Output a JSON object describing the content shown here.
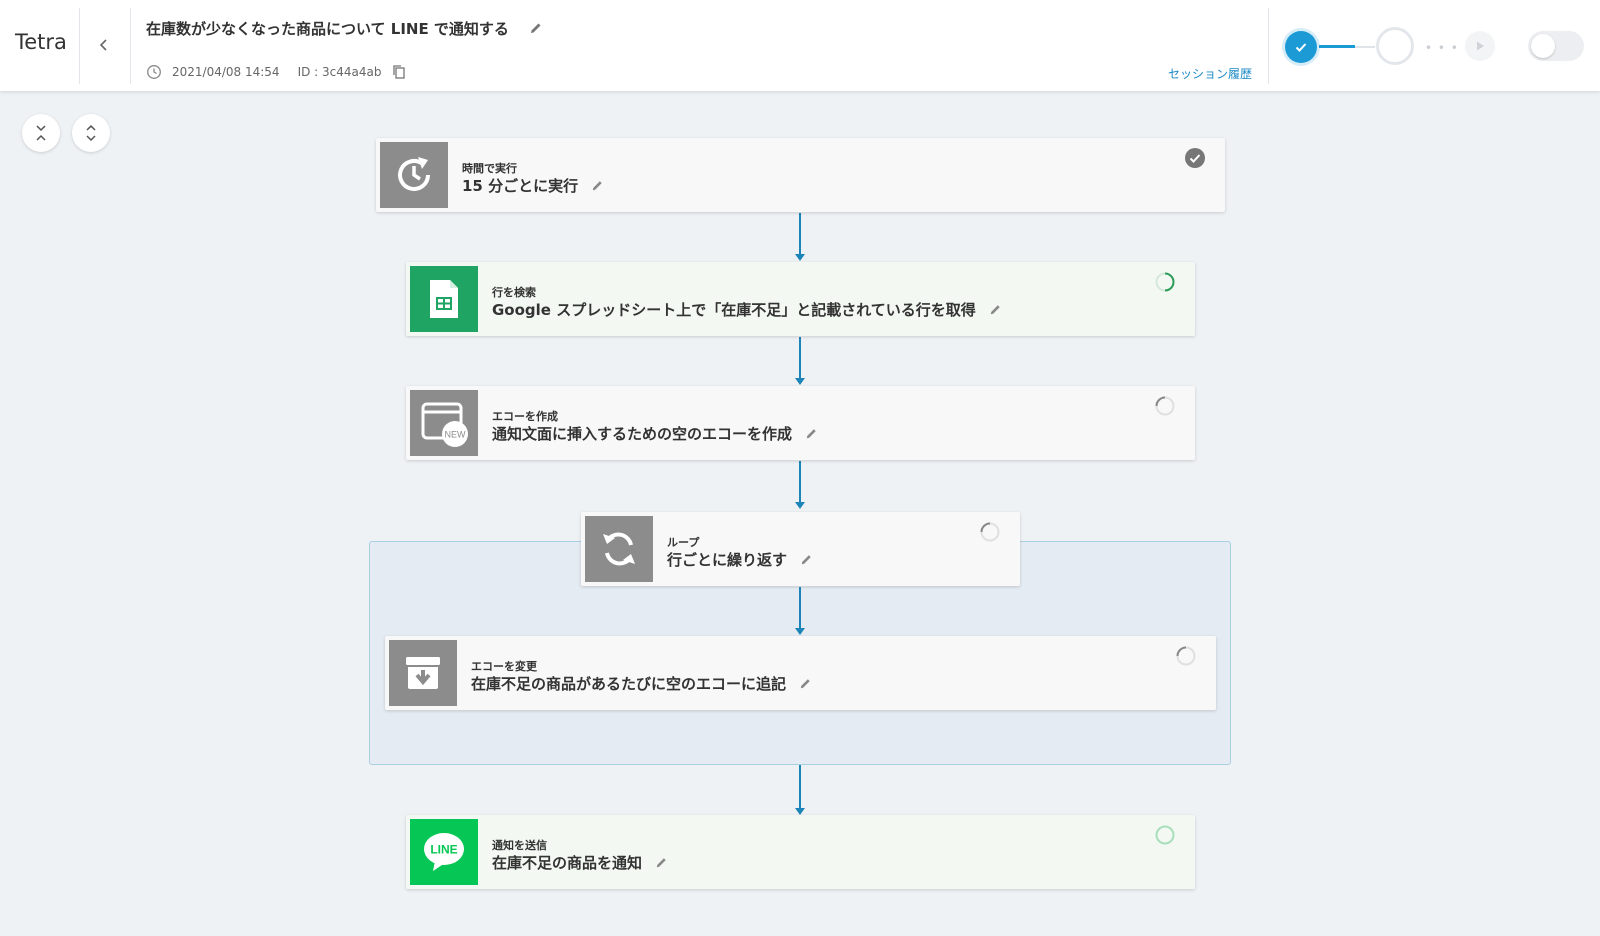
{
  "app": {
    "name": "Tetra"
  },
  "flow": {
    "title": "在庫数が少なくなった商品について LINE で通知する",
    "date": "2021/04/08 14:54",
    "id_text": "ID : 3c44a4ab",
    "session_history": "セッション履歴"
  },
  "colors": {
    "accent": "#1c9ad6",
    "connector": "#1d84b7",
    "sheets_green": "#1fa463",
    "line_green": "#06c755",
    "gray_icon": "#8c8c8c"
  },
  "steps": [
    {
      "kind": "時間で実行",
      "label": "15 分ごとに実行",
      "icon": "clock-refresh-icon",
      "status": "completed"
    },
    {
      "kind": "行を検索",
      "label": "Google スプレッドシート上で「在庫不足」と記載されている行を取得",
      "icon": "google-sheets-icon",
      "status": "running"
    },
    {
      "kind": "エコーを作成",
      "label": "通知文面に挿入するための空のエコーを作成",
      "icon": "new-echo-icon",
      "status": "pending"
    },
    {
      "kind": "ループ",
      "label": "行ごとに繰り返す",
      "icon": "loop-icon",
      "status": "pending"
    },
    {
      "kind": "エコーを変更",
      "label": "在庫不足の商品があるたびに空のエコーに追記",
      "icon": "archive-down-icon",
      "status": "pending"
    },
    {
      "kind": "通知を送信",
      "label": "在庫不足の商品を通知",
      "icon": "line-icon",
      "status": "pending",
      "line_badge": "LINE"
    }
  ],
  "new_badge": "NEW"
}
